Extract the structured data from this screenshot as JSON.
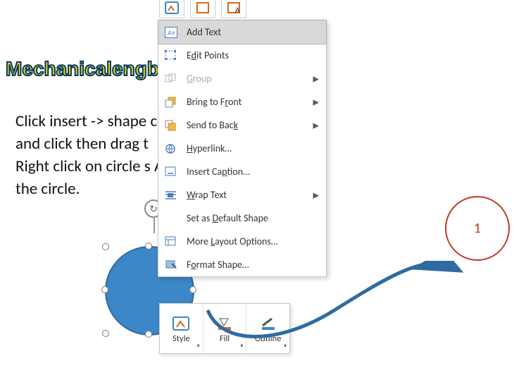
{
  "watermark": "Mechanicalengblog.com",
  "body_lines": [
    "Click insert -> shape                                       circle",
    "and click then drag t",
    "Right click on circle s                                         At t",
    "the circle."
  ],
  "context_menu": {
    "items": [
      {
        "label": "Add Text",
        "highlight": true,
        "submenu": false
      },
      {
        "label": "Edit Points",
        "u": 1,
        "submenu": false
      },
      {
        "label": "Group",
        "u": 0,
        "disabled": true,
        "submenu": true
      },
      {
        "label": "Bring to Front",
        "u": 9,
        "submenu": true
      },
      {
        "label": "Send to Back",
        "u": 8,
        "submenu": true
      },
      {
        "label": "Hyperlink…",
        "u": 0,
        "submenu": false
      },
      {
        "label": "Insert Caption…",
        "u": 7,
        "submenu": false
      },
      {
        "label": "Wrap Text",
        "u": 0,
        "submenu": true
      },
      {
        "label": "Set as Default Shape",
        "u": 7,
        "submenu": false
      },
      {
        "label": "More Layout Options…",
        "u": 5,
        "submenu": false
      },
      {
        "label": "Format Shape…",
        "u": 1,
        "submenu": false
      }
    ]
  },
  "mini_toolbar": {
    "style": "Style",
    "fill": "Fill",
    "outline": "Outline"
  },
  "result_circle": {
    "number": "1"
  },
  "colors": {
    "shape_fill": "#3c87c7",
    "shape_border": "#2f6ba1",
    "arrow": "#2f6ba1",
    "result_border": "#c0392b",
    "watermark_fill": "#ffd400",
    "watermark_stroke": "#003a66"
  }
}
